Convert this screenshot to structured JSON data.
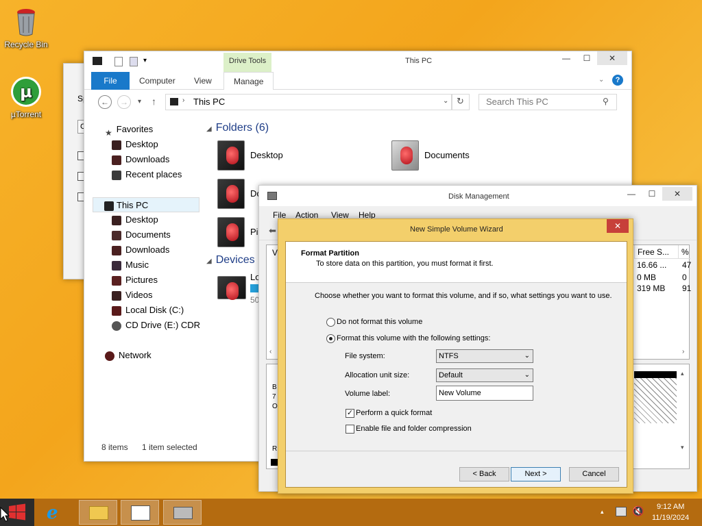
{
  "desktop": {
    "icons": [
      {
        "label": "Recycle Bin"
      },
      {
        "label": "µTorrent"
      }
    ]
  },
  "bg_window": {
    "chars": [
      "Sp",
      "C"
    ]
  },
  "explorer": {
    "title": "This PC",
    "drive_tools_label": "Drive Tools",
    "tabs": [
      "File",
      "Computer",
      "View",
      "Manage"
    ],
    "address": "This PC",
    "search_placeholder": "Search This PC",
    "nav": {
      "favorites": "Favorites",
      "favorites_items": [
        "Desktop",
        "Downloads",
        "Recent places"
      ],
      "this_pc": "This PC",
      "pc_items": [
        "Desktop",
        "Documents",
        "Downloads",
        "Music",
        "Pictures",
        "Videos",
        "Local Disk (C:)",
        "CD Drive (E:) CDR"
      ],
      "network": "Network"
    },
    "folders_heading": "Folders (6)",
    "folders": [
      "Desktop",
      "Documents",
      "Do",
      "Pi"
    ],
    "devices_heading": "Devices",
    "device_partial": "Lo",
    "device_partial_size": "50",
    "status_items": "8 items",
    "status_selected": "1 item selected"
  },
  "disk_mgmt": {
    "title": "Disk Management",
    "menu": [
      "File",
      "Action",
      "View",
      "Help"
    ],
    "col_v": "V",
    "col_free": "Free S...",
    "col_pct": "%",
    "rows": [
      {
        "free": "16.66 ...",
        "pct": "47"
      },
      {
        "free": "0 MB",
        "pct": "0"
      },
      {
        "free": "319 MB",
        "pct": "91"
      }
    ],
    "left_chars": [
      "B",
      "7",
      "O",
      "R"
    ]
  },
  "wizard": {
    "title": "New Simple Volume Wizard",
    "header_title": "Format Partition",
    "header_sub": "To store data on this partition, you must format it first.",
    "prompt": "Choose whether you want to format this volume, and if so, what settings you want to use.",
    "opt_no_format": "Do not format this volume",
    "opt_format": "Format this volume with the following settings:",
    "fs_label": "File system:",
    "fs_value": "NTFS",
    "alloc_label": "Allocation unit size:",
    "alloc_value": "Default",
    "vol_label": "Volume label:",
    "vol_value": "New Volume",
    "quick_format": "Perform a quick format",
    "compression": "Enable file and folder compression",
    "back": "< Back",
    "next": "Next >",
    "cancel": "Cancel"
  },
  "taskbar": {
    "time": "9:12 AM",
    "date": "11/19/2024"
  },
  "colors": {
    "accent": "#1979ca",
    "drive_tools": "#dcf0c8",
    "wizard_frame": "#f3cf6b",
    "taskbar": "#b46b10"
  }
}
